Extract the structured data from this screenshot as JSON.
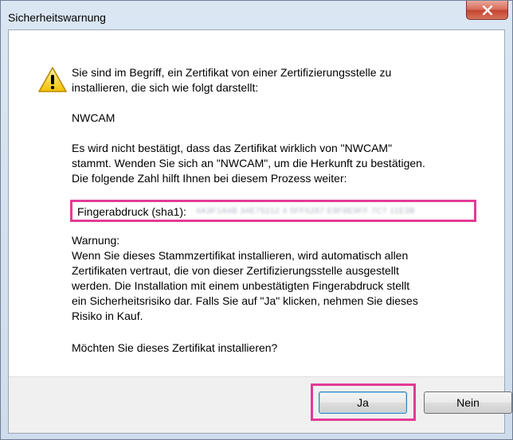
{
  "window": {
    "title": "Sicherheitswarnung"
  },
  "icons": {
    "warning": "warning-triangle-icon",
    "close": "close-icon"
  },
  "message": {
    "intro": "Sie sind im Begriff, ein Zertifikat von einer Zertifizierungsstelle zu\ninstallieren, die sich wie folgt darstellt:",
    "issuer": "NWCAM",
    "not_confirmed": "Es wird nicht bestätigt, dass das Zertifikat wirklich von \"NWCAM\"\nstammt. Wenden Sie sich an \"NWCAM\", um die Herkunft zu bestätigen.\nDie folgende Zahl hilft Ihnen bei diesem Prozess weiter:",
    "fingerprint_label": "Fingerabdruck (sha1):",
    "fingerprint_value": "4A3F1A4B 34E75212 4 5FF5287 E8F8E9FF 7C7 11E3B",
    "warning": "Warnung:\nWenn Sie dieses Stammzertifikat installieren, wird automatisch allen\nZertifikaten vertraut, die von dieser Zertifizierungsstelle ausgestellt\nwerden. Die Installation mit einem unbestätigten Fingerabdruck stellt\nein Sicherheitsrisiko dar. Falls Sie auf \"Ja\" klicken, nehmen Sie dieses\nRisiko in Kauf.",
    "question": "Möchten Sie dieses Zertifikat installieren?"
  },
  "buttons": {
    "yes": "Ja",
    "no": "Nein"
  },
  "colors": {
    "highlight": "#e23b96",
    "window_frame": "#cfdceb",
    "footer": "#f0f0f0"
  }
}
